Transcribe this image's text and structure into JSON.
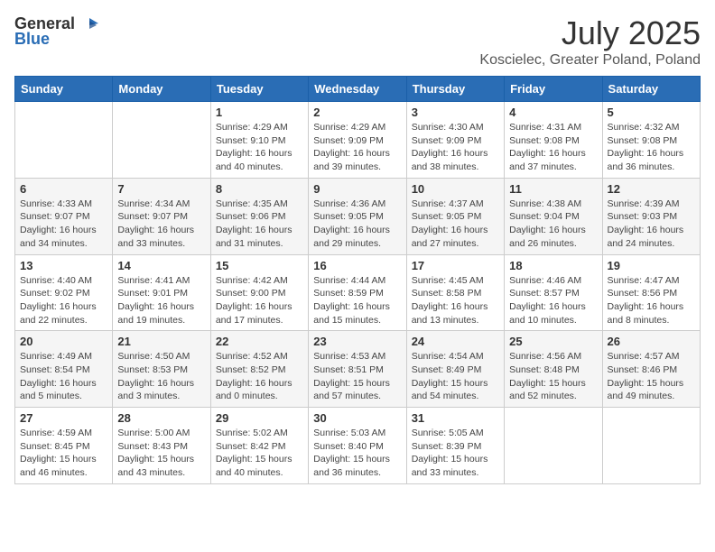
{
  "logo": {
    "general": "General",
    "blue": "Blue"
  },
  "title": "July 2025",
  "location": "Koscielec, Greater Poland, Poland",
  "days_of_week": [
    "Sunday",
    "Monday",
    "Tuesday",
    "Wednesday",
    "Thursday",
    "Friday",
    "Saturday"
  ],
  "weeks": [
    [
      {
        "day": "",
        "info": ""
      },
      {
        "day": "",
        "info": ""
      },
      {
        "day": "1",
        "info": "Sunrise: 4:29 AM\nSunset: 9:10 PM\nDaylight: 16 hours\nand 40 minutes."
      },
      {
        "day": "2",
        "info": "Sunrise: 4:29 AM\nSunset: 9:09 PM\nDaylight: 16 hours\nand 39 minutes."
      },
      {
        "day": "3",
        "info": "Sunrise: 4:30 AM\nSunset: 9:09 PM\nDaylight: 16 hours\nand 38 minutes."
      },
      {
        "day": "4",
        "info": "Sunrise: 4:31 AM\nSunset: 9:08 PM\nDaylight: 16 hours\nand 37 minutes."
      },
      {
        "day": "5",
        "info": "Sunrise: 4:32 AM\nSunset: 9:08 PM\nDaylight: 16 hours\nand 36 minutes."
      }
    ],
    [
      {
        "day": "6",
        "info": "Sunrise: 4:33 AM\nSunset: 9:07 PM\nDaylight: 16 hours\nand 34 minutes."
      },
      {
        "day": "7",
        "info": "Sunrise: 4:34 AM\nSunset: 9:07 PM\nDaylight: 16 hours\nand 33 minutes."
      },
      {
        "day": "8",
        "info": "Sunrise: 4:35 AM\nSunset: 9:06 PM\nDaylight: 16 hours\nand 31 minutes."
      },
      {
        "day": "9",
        "info": "Sunrise: 4:36 AM\nSunset: 9:05 PM\nDaylight: 16 hours\nand 29 minutes."
      },
      {
        "day": "10",
        "info": "Sunrise: 4:37 AM\nSunset: 9:05 PM\nDaylight: 16 hours\nand 27 minutes."
      },
      {
        "day": "11",
        "info": "Sunrise: 4:38 AM\nSunset: 9:04 PM\nDaylight: 16 hours\nand 26 minutes."
      },
      {
        "day": "12",
        "info": "Sunrise: 4:39 AM\nSunset: 9:03 PM\nDaylight: 16 hours\nand 24 minutes."
      }
    ],
    [
      {
        "day": "13",
        "info": "Sunrise: 4:40 AM\nSunset: 9:02 PM\nDaylight: 16 hours\nand 22 minutes."
      },
      {
        "day": "14",
        "info": "Sunrise: 4:41 AM\nSunset: 9:01 PM\nDaylight: 16 hours\nand 19 minutes."
      },
      {
        "day": "15",
        "info": "Sunrise: 4:42 AM\nSunset: 9:00 PM\nDaylight: 16 hours\nand 17 minutes."
      },
      {
        "day": "16",
        "info": "Sunrise: 4:44 AM\nSunset: 8:59 PM\nDaylight: 16 hours\nand 15 minutes."
      },
      {
        "day": "17",
        "info": "Sunrise: 4:45 AM\nSunset: 8:58 PM\nDaylight: 16 hours\nand 13 minutes."
      },
      {
        "day": "18",
        "info": "Sunrise: 4:46 AM\nSunset: 8:57 PM\nDaylight: 16 hours\nand 10 minutes."
      },
      {
        "day": "19",
        "info": "Sunrise: 4:47 AM\nSunset: 8:56 PM\nDaylight: 16 hours\nand 8 minutes."
      }
    ],
    [
      {
        "day": "20",
        "info": "Sunrise: 4:49 AM\nSunset: 8:54 PM\nDaylight: 16 hours\nand 5 minutes."
      },
      {
        "day": "21",
        "info": "Sunrise: 4:50 AM\nSunset: 8:53 PM\nDaylight: 16 hours\nand 3 minutes."
      },
      {
        "day": "22",
        "info": "Sunrise: 4:52 AM\nSunset: 8:52 PM\nDaylight: 16 hours\nand 0 minutes."
      },
      {
        "day": "23",
        "info": "Sunrise: 4:53 AM\nSunset: 8:51 PM\nDaylight: 15 hours\nand 57 minutes."
      },
      {
        "day": "24",
        "info": "Sunrise: 4:54 AM\nSunset: 8:49 PM\nDaylight: 15 hours\nand 54 minutes."
      },
      {
        "day": "25",
        "info": "Sunrise: 4:56 AM\nSunset: 8:48 PM\nDaylight: 15 hours\nand 52 minutes."
      },
      {
        "day": "26",
        "info": "Sunrise: 4:57 AM\nSunset: 8:46 PM\nDaylight: 15 hours\nand 49 minutes."
      }
    ],
    [
      {
        "day": "27",
        "info": "Sunrise: 4:59 AM\nSunset: 8:45 PM\nDaylight: 15 hours\nand 46 minutes."
      },
      {
        "day": "28",
        "info": "Sunrise: 5:00 AM\nSunset: 8:43 PM\nDaylight: 15 hours\nand 43 minutes."
      },
      {
        "day": "29",
        "info": "Sunrise: 5:02 AM\nSunset: 8:42 PM\nDaylight: 15 hours\nand 40 minutes."
      },
      {
        "day": "30",
        "info": "Sunrise: 5:03 AM\nSunset: 8:40 PM\nDaylight: 15 hours\nand 36 minutes."
      },
      {
        "day": "31",
        "info": "Sunrise: 5:05 AM\nSunset: 8:39 PM\nDaylight: 15 hours\nand 33 minutes."
      },
      {
        "day": "",
        "info": ""
      },
      {
        "day": "",
        "info": ""
      }
    ]
  ]
}
